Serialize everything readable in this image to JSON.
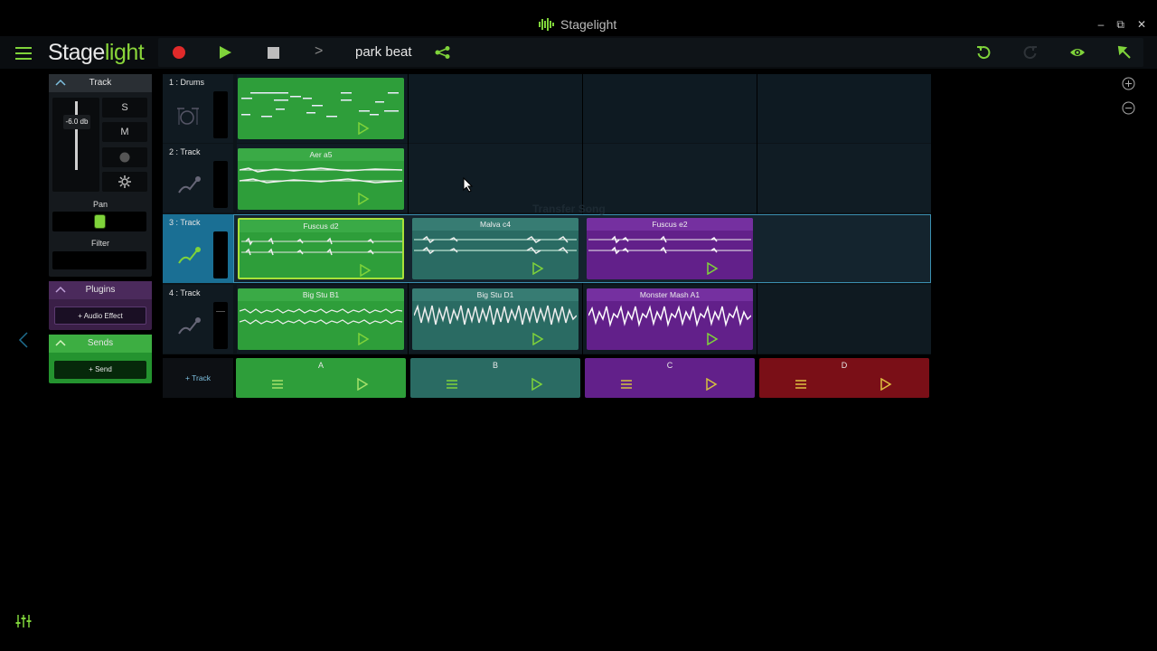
{
  "window": {
    "title": "Stagelight",
    "minimize": "‒",
    "restore": "⧉",
    "close": "✕"
  },
  "toolbar": {
    "logo_stage": "Stage",
    "logo_light": "light",
    "song_title": "park beat",
    "next_label": ">"
  },
  "left_panel": {
    "track_header": "Track",
    "fader_value": "-6.0 db",
    "solo": "S",
    "mute": "M",
    "pan_label": "Pan",
    "filter_label": "Filter",
    "plugins_header": "Plugins",
    "audio_effect_button": "+ Audio Effect",
    "sends_header": "Sends",
    "send_button": "+ Send"
  },
  "tracks": [
    {
      "name": "1 : Drums",
      "icon": "drum-kit-icon"
    },
    {
      "name": "2 : Track",
      "icon": "microphone-icon"
    },
    {
      "name": "3 : Track",
      "icon": "microphone-icon"
    },
    {
      "name": "4 : Track",
      "icon": "microphone-icon"
    }
  ],
  "clips": {
    "drums_a": "",
    "t2_a": "Aer a5",
    "t3_a": "Fuscus d2",
    "t3_b": "Malva c4",
    "t3_c": "Fuscus e2",
    "t4_a": "Big Stu B1",
    "t4_b": "Big Stu D1",
    "t4_c": "Monster Mash A1"
  },
  "scenes": [
    "A",
    "B",
    "C",
    "D"
  ],
  "add_track": "+ Track",
  "ghost_overlay": "Transfer Song",
  "colors": {
    "accent": "#7fd33a",
    "green_clip": "#2e9e3a",
    "teal_clip": "#2a6b63",
    "purple_clip": "#62208a",
    "red_scene": "#7a0f17",
    "selected_track": "#1a6f94"
  }
}
